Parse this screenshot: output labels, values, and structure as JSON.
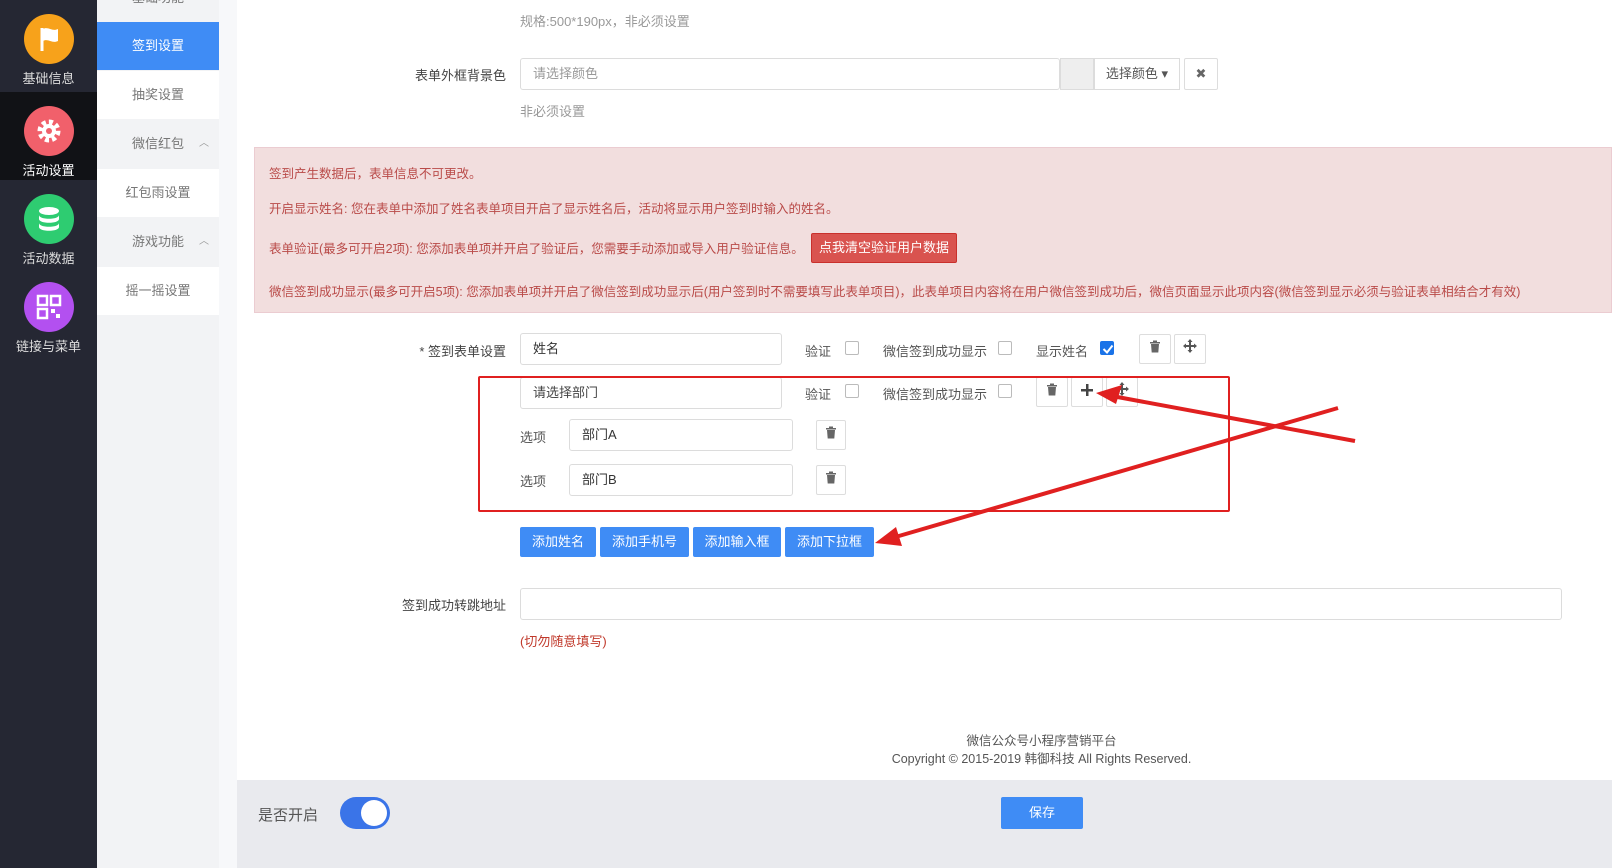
{
  "rail": {
    "items": [
      {
        "label": "基础信息",
        "icon": "flag-icon",
        "color": "#f7a21b"
      },
      {
        "label": "活动设置",
        "icon": "gear-icon",
        "color": "#f1606b"
      },
      {
        "label": "活动数据",
        "icon": "database-icon",
        "color": "#2ecc71"
      },
      {
        "label": "链接与菜单",
        "icon": "qrcode-icon",
        "color": "#b350f0"
      }
    ]
  },
  "submenu": {
    "top_partial": "基础功能",
    "items": [
      "签到设置",
      "抽奖设置",
      "微信红包",
      "红包雨设置",
      "游戏功能",
      "摇一摇设置"
    ]
  },
  "top_hint": "规格:500*190px，非必须设置",
  "bg_color": {
    "label": "表单外框背景色",
    "placeholder": "请选择颜色",
    "select_label": "选择颜色 ▾",
    "clear_label": "✖",
    "hint": "非必须设置"
  },
  "alert": {
    "line1": "签到产生数据后，表单信息不可更改。",
    "line2": "开启显示姓名: 您在表单中添加了姓名表单项目开启了显示姓名后，活动将显示用户签到时输入的姓名。",
    "line3": "表单验证(最多可开启2项): 您添加表单项并开启了验证后，您需要手动添加或导入用户验证信息。",
    "clear_button": "点我清空验证用户数据",
    "line4": "微信签到成功显示(最多可开启5项): 您添加表单项并开启了微信签到成功显示后(用户签到时不需要填写此表单项目)，此表单项目内容将在用户微信签到成功后，微信页面显示此项内容(微信签到显示必须与验证表单相结合才有效)"
  },
  "form": {
    "label": "* 签到表单设置",
    "row1": {
      "value": "姓名",
      "verify": "验证",
      "wechat_show": "微信签到成功显示",
      "show_name": "显示姓名",
      "show_name_checked": true
    },
    "row2": {
      "placeholder": "请选择部门",
      "verify": "验证",
      "wechat_show": "微信签到成功显示"
    },
    "options": [
      {
        "label": "选项",
        "value": "部门A"
      },
      {
        "label": "选项",
        "value": "部门B"
      }
    ],
    "add_buttons": [
      "添加姓名",
      "添加手机号",
      "添加输入框",
      "添加下拉框"
    ]
  },
  "redirect": {
    "label": "签到成功转跳地址",
    "value": "",
    "warning": "(切勿随意填写)"
  },
  "footer": {
    "line1": "微信公众号小程序营销平台",
    "line2": "Copyright © 2015-2019 韩御科技 All Rights Reserved."
  },
  "bottom_bar": {
    "toggle_label": "是否开启",
    "toggle_on": true,
    "save": "保存"
  },
  "colors": {
    "primary": "#3f8cf5",
    "danger": "#d9534f",
    "annotation": "#e02020"
  }
}
